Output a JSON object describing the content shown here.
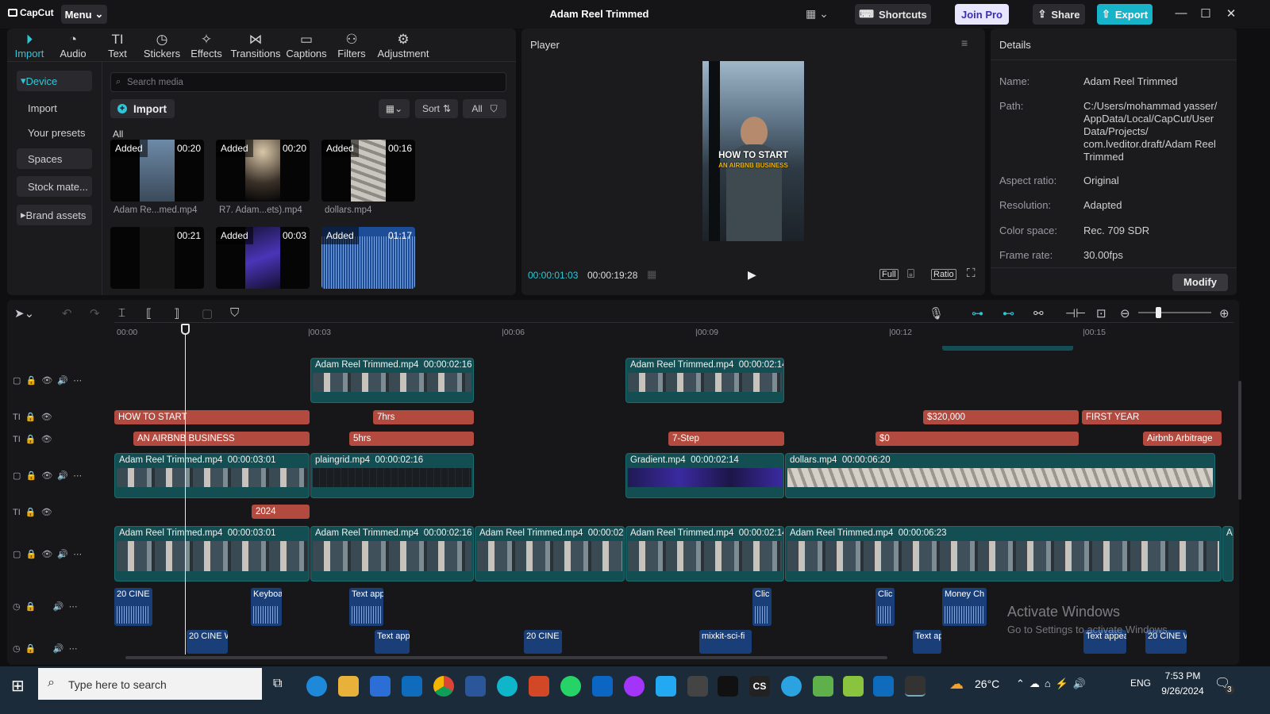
{
  "titlebar": {
    "app": "CapCut",
    "menu": "Menu",
    "project_title": "Adam Reel Trimmed",
    "shortcuts": "Shortcuts",
    "join_pro": "Join Pro",
    "share": "Share",
    "export": "Export"
  },
  "media_tabs": [
    {
      "label": "Import",
      "icon": "import-icon"
    },
    {
      "label": "Audio",
      "icon": "audio-icon"
    },
    {
      "label": "Text",
      "icon": "text-icon"
    },
    {
      "label": "Stickers",
      "icon": "sticker-icon"
    },
    {
      "label": "Effects",
      "icon": "effects-icon"
    },
    {
      "label": "Transitions",
      "icon": "transitions-icon"
    },
    {
      "label": "Captions",
      "icon": "captions-icon"
    },
    {
      "label": "Filters",
      "icon": "filters-icon"
    },
    {
      "label": "Adjustment",
      "icon": "adjustment-icon"
    }
  ],
  "sidebar": {
    "items": [
      "Device",
      "Import",
      "Your presets",
      "Spaces",
      "Stock mate...",
      "Brand assets"
    ]
  },
  "media": {
    "search_placeholder": "Search media",
    "import_label": "Import",
    "sort_label": "Sort",
    "filter_label": "All",
    "section": "All",
    "items": [
      {
        "badge": "Added",
        "duration": "00:20",
        "caption": "Adam Re...med.mp4"
      },
      {
        "badge": "Added",
        "duration": "00:20",
        "caption": "R7. Adam...ets).mp4"
      },
      {
        "badge": "Added",
        "duration": "00:16",
        "caption": "dollars.mp4"
      },
      {
        "badge": "",
        "duration": "00:21",
        "caption": ""
      },
      {
        "badge": "Added",
        "duration": "00:03",
        "caption": ""
      },
      {
        "badge": "Added",
        "duration": "01:17",
        "caption": ""
      }
    ]
  },
  "player": {
    "title": "Player",
    "current_time": "00:00:01:03",
    "total_time": "00:00:19:28",
    "full_label": "Full",
    "ratio_label": "Ratio",
    "overlay_line1": "HOW TO START",
    "overlay_line2": "AN AIRBNB BUSINESS"
  },
  "details": {
    "title": "Details",
    "modify": "Modify",
    "rows": [
      {
        "label": "Name:",
        "value": "Adam Reel Trimmed"
      },
      {
        "label": "Path:",
        "value": "C:/Users/mohammad yasser/ AppData/Local/CapCut/User Data/Projects/ com.lveditor.draft/Adam Reel Trimmed"
      },
      {
        "label": "Aspect ratio:",
        "value": "Original"
      },
      {
        "label": "Resolution:",
        "value": "Adapted"
      },
      {
        "label": "Color space:",
        "value": "Rec. 709 SDR"
      },
      {
        "label": "Frame rate:",
        "value": "30.00fps"
      }
    ]
  },
  "timeline": {
    "ruler": [
      "00:00",
      "|00:03",
      "|00:06",
      "|00:09",
      "|00:12",
      "|00:15"
    ],
    "video_clips_top": [
      {
        "name": "Adam Reel Trimmed.mp4",
        "dur": "00:00:02:16"
      },
      {
        "name": "Adam Reel Trimmed.mp4",
        "dur": "00:00:02:14"
      }
    ],
    "text_row1": [
      "HOW TO START",
      "7hrs",
      "$320,000",
      "FIRST YEAR"
    ],
    "text_row2": [
      "AN AIRBNB BUSINESS",
      "5hrs",
      "7-Step",
      "$0",
      "Airbnb Arbitrage"
    ],
    "video_clips_mid": [
      {
        "name": "Adam Reel Trimmed.mp4",
        "dur": "00:00:03:01"
      },
      {
        "name": "plaingrid.mp4",
        "dur": "00:00:02:16"
      },
      {
        "name": "Gradient.mp4",
        "dur": "00:00:02:14"
      },
      {
        "name": "dollars.mp4",
        "dur": "00:00:06:20"
      }
    ],
    "text_row3": [
      "2024"
    ],
    "main_clips": [
      {
        "name": "Adam Reel Trimmed.mp4",
        "dur": "00:00:03:01"
      },
      {
        "name": "Adam Reel Trimmed.mp4",
        "dur": "00:00:02:16"
      },
      {
        "name": "Adam Reel Trimmed.mp4",
        "dur": "00:00:02:1"
      },
      {
        "name": "Adam Reel Trimmed.mp4",
        "dur": "00:00:02:14"
      },
      {
        "name": "Adam Reel Trimmed.mp4",
        "dur": "00:00:06:23"
      },
      {
        "name": "A",
        "dur": ""
      }
    ],
    "audio_row1": [
      "20 CINE ",
      "Keyboa",
      "Text app",
      "Clic",
      "Clic",
      "Money Ch"
    ],
    "audio_row2": [
      "20 CINE W",
      "Text app",
      "20 CINE V",
      "mixkit-sci-fi",
      "Text ap",
      "Text appea",
      "20 CINE W"
    ]
  },
  "watermark": {
    "line1": "Activate Windows",
    "line2": "Go to Settings to activate Windows."
  },
  "taskbar": {
    "search_placeholder": "Type here to search",
    "temperature": "26°C",
    "language": "ENG",
    "time": "7:53 PM",
    "date": "9/26/2024",
    "notifications": "3"
  }
}
